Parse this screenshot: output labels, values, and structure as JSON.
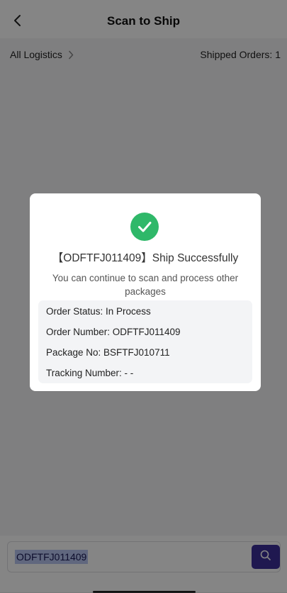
{
  "header": {
    "title": "Scan to Ship",
    "back_icon": "chevron-left-icon"
  },
  "subbar": {
    "logistics_label": "All Logistics",
    "shipped_label": "Shipped Orders: ",
    "shipped_count": "1"
  },
  "scan": {
    "value": "ODFTFJ011409",
    "button_icon": "search-icon",
    "button_color": "#3d2f9a"
  },
  "dialog": {
    "icon": "check-circle-icon",
    "icon_color": "#2fb869",
    "title": "【ODFTFJ011409】Ship Successfully",
    "message": "You can continue to scan and process other packages",
    "info": {
      "order_status": "Order Status: In Process",
      "order_number": "Order Number: ODFTFJ011409",
      "package_no": "Package No: BSFTFJ010711",
      "tracking_number": "Tracking Number: - -"
    }
  }
}
